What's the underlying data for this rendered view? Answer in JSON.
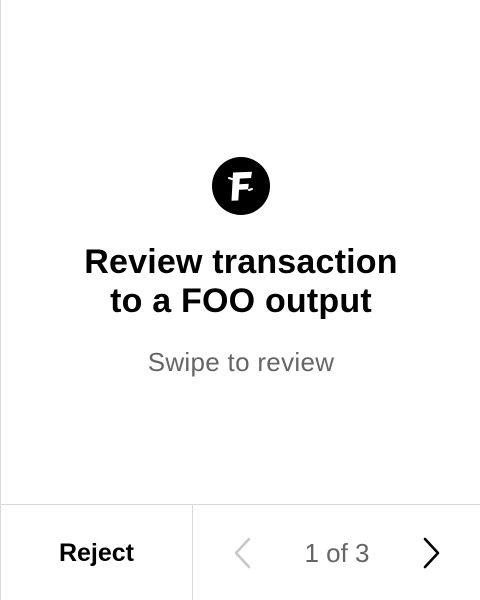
{
  "logo": {
    "icon": "foo-coin-icon",
    "letter": "F",
    "color": "#000000"
  },
  "heading": {
    "line1": "Review transaction",
    "line2": "to a FOO output"
  },
  "subtitle": "Swipe to review",
  "footer": {
    "reject_label": "Reject",
    "page_indicator": "1 of 3",
    "prev_icon": "chevron-left-icon",
    "next_icon": "chevron-right-icon"
  },
  "colors": {
    "text_primary": "#000000",
    "text_secondary": "#666666",
    "divider": "#d9d9d9",
    "disabled_icon": "#c8c8c8"
  }
}
